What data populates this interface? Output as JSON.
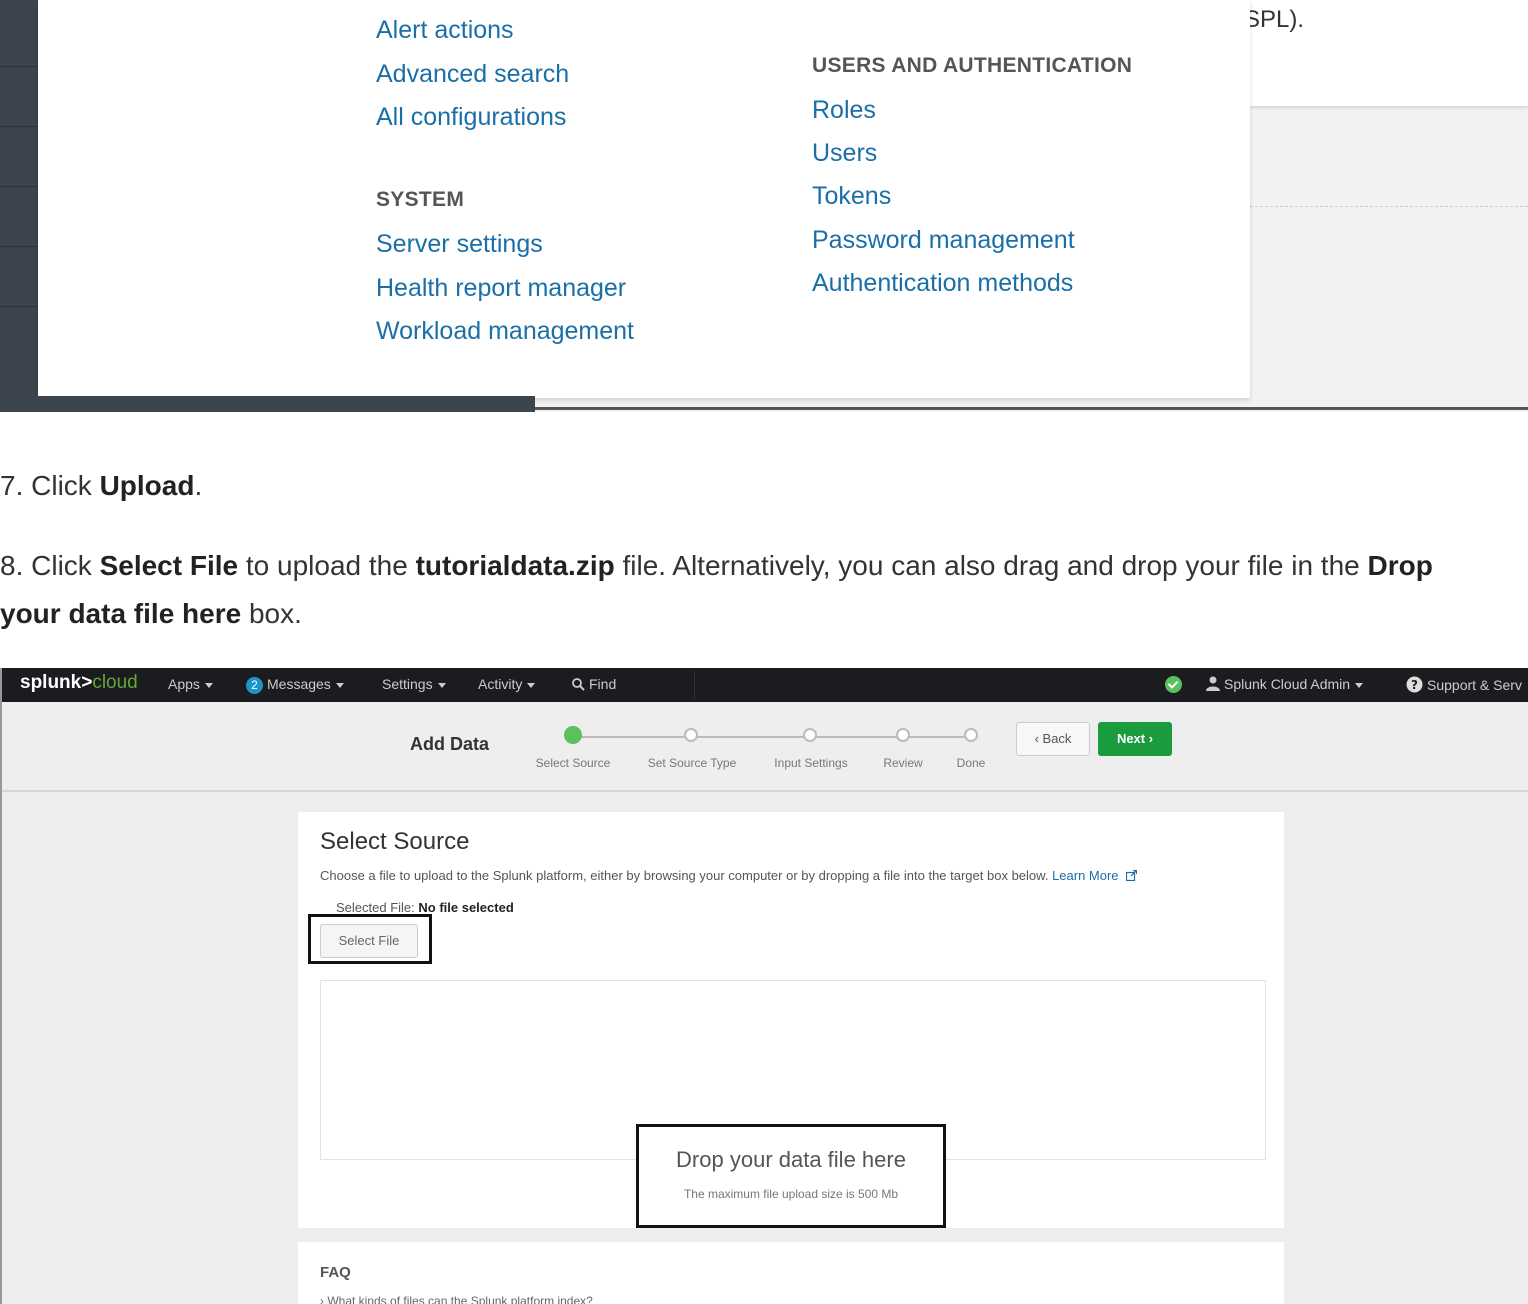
{
  "settings_menu": {
    "col1_links_top": [
      "Alert actions",
      "Advanced search",
      "All configurations"
    ],
    "system_heading": "SYSTEM",
    "system_links": [
      "Server settings",
      "Health report manager",
      "Workload management"
    ],
    "users_heading": "USERS AND AUTHENTICATION",
    "users_links": [
      "Roles",
      "Users",
      "Tokens",
      "Password management",
      "Authentication methods"
    ],
    "partial_text": "SPL)."
  },
  "steps": {
    "step7_prefix": "7. Click ",
    "step7_bold": "Upload",
    "step7_suffix": ".",
    "step8_prefix": "8. Click ",
    "step8_bold1": "Select File",
    "step8_mid1": " to upload the ",
    "step8_bold2": "tutorialdata.zip",
    "step8_mid2": " file. Alternatively, you can also drag and drop your file in the ",
    "step8_bold3a": "Drop",
    "step8_bold3b": "your data file here",
    "step8_suffix": " box."
  },
  "navbar": {
    "logo_main": "splunk>",
    "logo_accent": "cloud",
    "apps": "Apps",
    "messages_count": "2",
    "messages": "Messages",
    "settings": "Settings",
    "activity": "Activity",
    "find": "Find",
    "user": "Splunk Cloud Admin",
    "support": "Support & Serv"
  },
  "wizard": {
    "title": "Add Data",
    "steps": [
      "Select Source",
      "Set Source Type",
      "Input Settings",
      "Review",
      "Done"
    ],
    "current_step": 0,
    "back": "‹ Back",
    "next": "Next ›"
  },
  "select_source": {
    "title": "Select Source",
    "description": "Choose a file to upload to the Splunk platform, either by browsing your computer or by dropping a file into the target box below.",
    "learn_more": "Learn More",
    "selected_file_label": "Selected File:",
    "selected_file_value": "No file selected",
    "select_file_button": "Select File",
    "drop_title": "Drop your data file here",
    "drop_sub": "The maximum file upload size is 500 Mb"
  },
  "faq": {
    "title": "FAQ",
    "question1": "› What kinds of files can the Splunk platform index?"
  },
  "colors": {
    "link": "#1a6fa8",
    "active_step": "#5cc05c",
    "next_button": "#1a9c3e",
    "navbar": "#1a1c20"
  }
}
